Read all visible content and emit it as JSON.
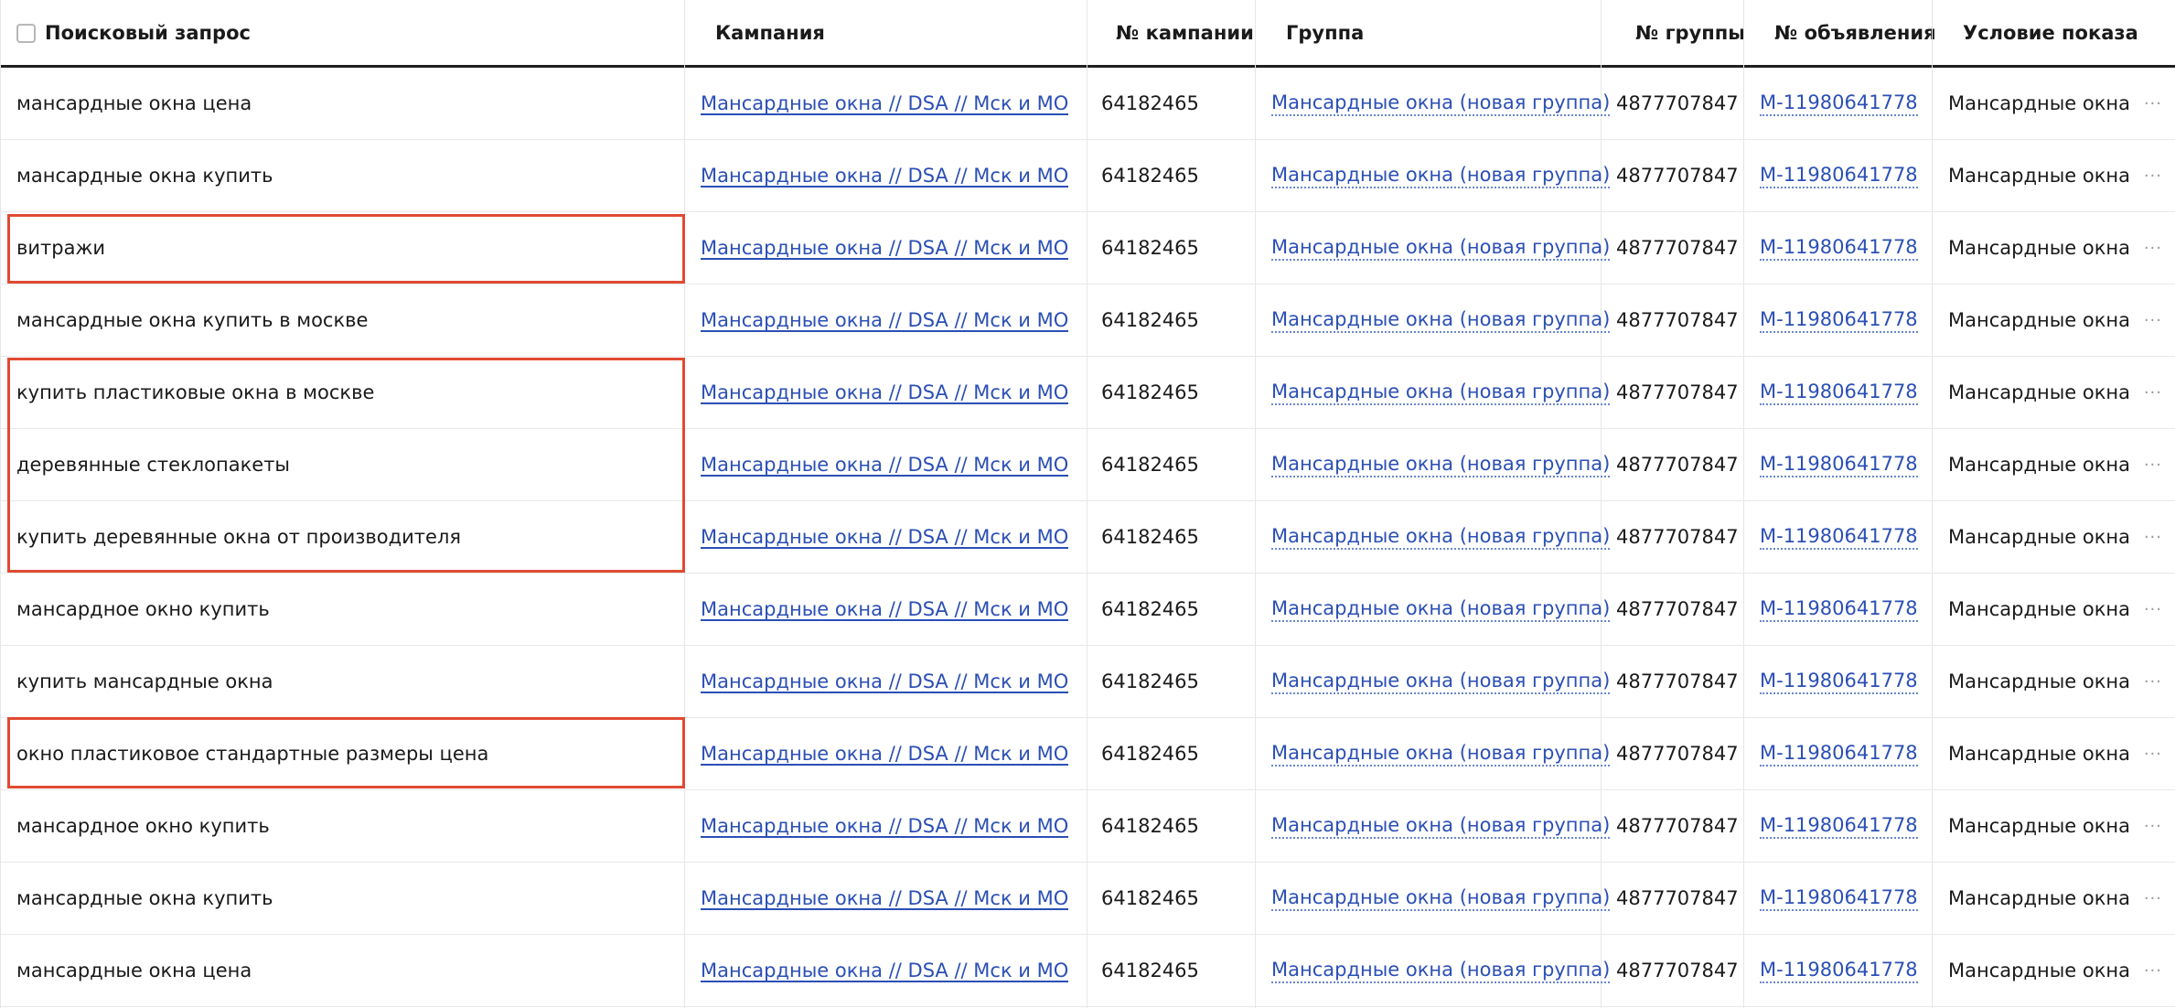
{
  "columns": {
    "query": "Поисковый запрос",
    "campaign": "Кампания",
    "campaign_id": "№ кампании",
    "group": "Группа",
    "group_id": "№ группы",
    "ad_id": "№ объявления",
    "condition": "Условие показа"
  },
  "row_menu_icon": "ellipsis-icon",
  "highlight_color": "#e04a33",
  "link_color": "#2b4fb5",
  "rows": [
    {
      "query": "мансардные окна цена",
      "campaign": "Мансардные окна // DSA // Мск и МО",
      "campaign_id": "64182465",
      "group": "Мансардные окна (новая группа)",
      "group_id": "4877707847",
      "ad_id": "M-11980641778",
      "condition": "Мансардные окна",
      "menu": "···"
    },
    {
      "query": "мансардные окна купить",
      "campaign": "Мансардные окна // DSA // Мск и МО",
      "campaign_id": "64182465",
      "group": "Мансардные окна (новая группа)",
      "group_id": "4877707847",
      "ad_id": "M-11980641778",
      "condition": "Мансардные окна",
      "menu": "···"
    },
    {
      "query": "витражи",
      "campaign": "Мансардные окна // DSA // Мск и МО",
      "campaign_id": "64182465",
      "group": "Мансардные окна (новая группа)",
      "group_id": "4877707847",
      "ad_id": "M-11980641778",
      "condition": "Мансардные окна",
      "menu": "···"
    },
    {
      "query": "мансардные окна купить в москве",
      "campaign": "Мансардные окна // DSA // Мск и МО",
      "campaign_id": "64182465",
      "group": "Мансардные окна (новая группа)",
      "group_id": "4877707847",
      "ad_id": "M-11980641778",
      "condition": "Мансардные окна",
      "menu": "···"
    },
    {
      "query": "купить пластиковые окна в москве",
      "campaign": "Мансардные окна // DSA // Мск и МО",
      "campaign_id": "64182465",
      "group": "Мансардные окна (новая группа)",
      "group_id": "4877707847",
      "ad_id": "M-11980641778",
      "condition": "Мансардные окна",
      "menu": "···"
    },
    {
      "query": "деревянные стеклопакеты",
      "campaign": "Мансардные окна // DSA // Мск и МО",
      "campaign_id": "64182465",
      "group": "Мансардные окна (новая группа)",
      "group_id": "4877707847",
      "ad_id": "M-11980641778",
      "condition": "Мансардные окна",
      "menu": "···"
    },
    {
      "query": "купить деревянные окна от производителя",
      "campaign": "Мансардные окна // DSA // Мск и МО",
      "campaign_id": "64182465",
      "group": "Мансардные окна (новая группа)",
      "group_id": "4877707847",
      "ad_id": "M-11980641778",
      "condition": "Мансардные окна",
      "menu": "···"
    },
    {
      "query": "мансардное окно купить",
      "campaign": "Мансардные окна // DSA // Мск и МО",
      "campaign_id": "64182465",
      "group": "Мансардные окна (новая группа)",
      "group_id": "4877707847",
      "ad_id": "M-11980641778",
      "condition": "Мансардные окна",
      "menu": "···"
    },
    {
      "query": "купить мансардные окна",
      "campaign": "Мансардные окна // DSA // Мск и МО",
      "campaign_id": "64182465",
      "group": "Мансардные окна (новая группа)",
      "group_id": "4877707847",
      "ad_id": "M-11980641778",
      "condition": "Мансардные окна",
      "menu": "···"
    },
    {
      "query": "окно пластиковое стандартные размеры цена",
      "campaign": "Мансардные окна // DSA // Мск и МО",
      "campaign_id": "64182465",
      "group": "Мансардные окна (новая группа)",
      "group_id": "4877707847",
      "ad_id": "M-11980641778",
      "condition": "Мансардные окна",
      "menu": "···"
    },
    {
      "query": "мансардное окно купить",
      "campaign": "Мансардные окна // DSA // Мск и МО",
      "campaign_id": "64182465",
      "group": "Мансардные окна (новая группа)",
      "group_id": "4877707847",
      "ad_id": "M-11980641778",
      "condition": "Мансардные окна",
      "menu": "···"
    },
    {
      "query": "мансардные окна купить",
      "campaign": "Мансардные окна // DSA // Мск и МО",
      "campaign_id": "64182465",
      "group": "Мансардные окна (новая группа)",
      "group_id": "4877707847",
      "ad_id": "M-11980641778",
      "condition": "Мансардные окна",
      "menu": "···"
    },
    {
      "query": "мансардные окна цена",
      "campaign": "Мансардные окна // DSA // Мск и МО",
      "campaign_id": "64182465",
      "group": "Мансардные окна (новая группа)",
      "group_id": "4877707847",
      "ad_id": "M-11980641778",
      "condition": "Мансардные окна",
      "menu": "···"
    }
  ]
}
